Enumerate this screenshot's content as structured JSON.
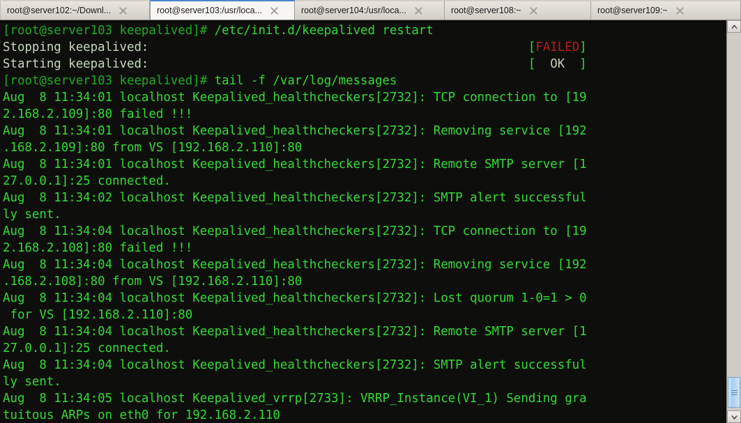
{
  "window": {
    "title": "root@server103:/usr/local",
    "accent_color": "#4a86c8",
    "terminal_bg": "#0e0f0d",
    "terminal_fg": "#35d935",
    "failed_color": "#b81a1a",
    "ok_color": "#c6cfb8"
  },
  "tabbar": {
    "tabs": [
      {
        "label": "root@server102:~/Downl...",
        "active": false,
        "close_icon": "close-icon"
      },
      {
        "label": "root@server103:/usr/loca...",
        "active": true,
        "close_icon": "close-icon"
      },
      {
        "label": "root@server104:/usr/loca...",
        "active": false,
        "close_icon": "close-icon"
      },
      {
        "label": "root@server108:~",
        "active": false,
        "close_icon": "close-icon"
      },
      {
        "label": "root@server109:~",
        "active": false,
        "close_icon": "close-icon"
      }
    ]
  },
  "terminal": {
    "prompt": "[root@server103 keepalived]# ",
    "commands": [
      "/etc/init.d/keepalived restart",
      "tail -f /var/log/messages"
    ],
    "status": {
      "stopping_label": "Stopping keepalived:",
      "stopping_result": "FAILED",
      "starting_label": "Starting keepalived:",
      "starting_result": "OK"
    },
    "lines": [
      {
        "type": "prompt",
        "prompt": "[root@server103 keepalived]# ",
        "cmd": "/etc/init.d/keepalived restart"
      },
      {
        "type": "service",
        "label": "Stopping keepalived:",
        "result": "FAILED",
        "result_kind": "failed"
      },
      {
        "type": "service",
        "label": "Starting keepalived:",
        "result": "OK",
        "result_kind": "ok"
      },
      {
        "type": "prompt",
        "prompt": "[root@server103 keepalived]# ",
        "cmd": "tail -f /var/log/messages"
      },
      {
        "type": "log",
        "text": "Aug  8 11:34:01 localhost Keepalived_healthcheckers[2732]: TCP connection to [19"
      },
      {
        "type": "log",
        "text": "2.168.2.109]:80 failed !!!"
      },
      {
        "type": "log",
        "text": "Aug  8 11:34:01 localhost Keepalived_healthcheckers[2732]: Removing service [192"
      },
      {
        "type": "log",
        "text": ".168.2.109]:80 from VS [192.168.2.110]:80"
      },
      {
        "type": "log",
        "text": "Aug  8 11:34:01 localhost Keepalived_healthcheckers[2732]: Remote SMTP server [1"
      },
      {
        "type": "log",
        "text": "27.0.0.1]:25 connected."
      },
      {
        "type": "log",
        "text": "Aug  8 11:34:02 localhost Keepalived_healthcheckers[2732]: SMTP alert successful"
      },
      {
        "type": "log",
        "text": "ly sent."
      },
      {
        "type": "log",
        "text": "Aug  8 11:34:04 localhost Keepalived_healthcheckers[2732]: TCP connection to [19"
      },
      {
        "type": "log",
        "text": "2.168.2.108]:80 failed !!!"
      },
      {
        "type": "log",
        "text": "Aug  8 11:34:04 localhost Keepalived_healthcheckers[2732]: Removing service [192"
      },
      {
        "type": "log",
        "text": ".168.2.108]:80 from VS [192.168.2.110]:80"
      },
      {
        "type": "log",
        "text": "Aug  8 11:34:04 localhost Keepalived_healthcheckers[2732]: Lost quorum 1-0=1 > 0"
      },
      {
        "type": "log",
        "text": " for VS [192.168.2.110]:80"
      },
      {
        "type": "log",
        "text": "Aug  8 11:34:04 localhost Keepalived_healthcheckers[2732]: Remote SMTP server [1"
      },
      {
        "type": "log",
        "text": "27.0.0.1]:25 connected."
      },
      {
        "type": "log",
        "text": "Aug  8 11:34:04 localhost Keepalived_healthcheckers[2732]: SMTP alert successful"
      },
      {
        "type": "log",
        "text": "ly sent."
      },
      {
        "type": "log",
        "text": "Aug  8 11:34:05 localhost Keepalived_vrrp[2733]: VRRP_Instance(VI_1) Sending gra"
      },
      {
        "type": "log",
        "text": "tuitous ARPs on eth0 for 192.168.2.110"
      }
    ]
  },
  "scrollbar": {
    "up_icon": "chevron-up-icon",
    "down_icon": "chevron-down-icon",
    "thumb_position": "bottom"
  }
}
